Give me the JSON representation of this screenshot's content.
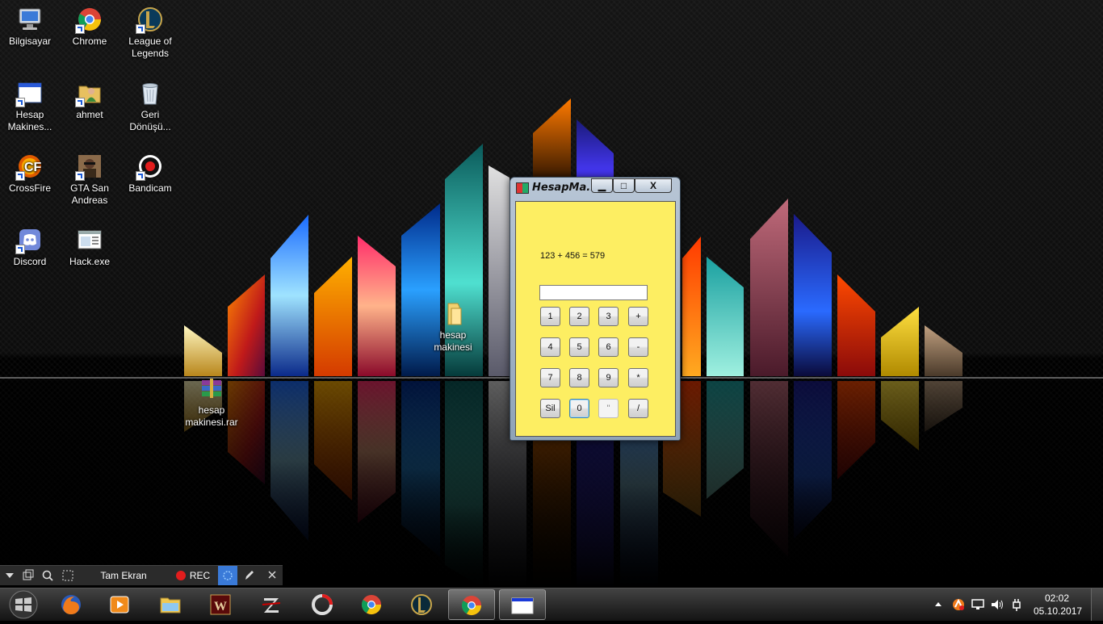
{
  "desktop": {
    "icons": [
      {
        "label": "Bilgisayar"
      },
      {
        "label": "Chrome"
      },
      {
        "label": "League of Legends"
      },
      {
        "label": "Hesap Makines..."
      },
      {
        "label": "ahmet"
      },
      {
        "label": "Geri Dönüşü..."
      },
      {
        "label": "CrossFire"
      },
      {
        "label": "GTA San Andreas"
      },
      {
        "label": "Bandicam"
      },
      {
        "label": "Discord"
      },
      {
        "label": "Hack.exe"
      },
      {
        "label": "hesap makinesi"
      },
      {
        "label": "hesap makinesi.rar"
      }
    ]
  },
  "calculator": {
    "title": "HesapMa...",
    "minimize": "▁",
    "maximize": "□",
    "close": "X",
    "result_text": "123 + 456 = 579",
    "input_value": "",
    "keys": [
      "1",
      "2",
      "3",
      "+",
      "4",
      "5",
      "6",
      "-",
      "7",
      "8",
      "9",
      "*",
      "Sil",
      "0",
      "\"",
      "/"
    ]
  },
  "bandicam": {
    "mode_label": "Tam Ekran",
    "rec_label": "REC"
  },
  "taskbar": {
    "apps": [
      "Firefox",
      "Windows Media Player",
      "Windows Explorer",
      "Wolfteam",
      "Zula",
      "OBS",
      "Chrome",
      "League of Legends",
      "Chrome",
      "Hesap Makinesi"
    ],
    "clock_time": "02:02",
    "clock_date": "05.10.2017"
  },
  "colors": {
    "calc_background": "#fdee62",
    "rec_red": "#e21d1d"
  }
}
